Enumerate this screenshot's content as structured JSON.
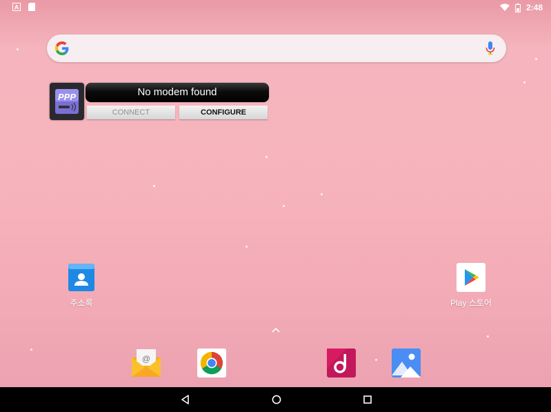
{
  "status_bar": {
    "time": "2:48",
    "notifications": [
      "font-a-icon",
      "sd-card-icon"
    ],
    "indicators": [
      "wifi-icon",
      "battery-icon"
    ]
  },
  "search": {
    "placeholder": "",
    "logo": "google-g-icon",
    "mic": "mic-icon"
  },
  "ppp_widget": {
    "icon_text": "PPP",
    "status": "No modem found",
    "connect_label": "CONNECT",
    "configure_label": "CONFIGURE"
  },
  "apps": {
    "contacts": {
      "label": "주소록",
      "icon": "contacts-icon"
    },
    "play_store": {
      "label": "Play 스토어",
      "icon": "play-store-icon"
    }
  },
  "dock": [
    {
      "name": "email",
      "icon": "email-icon"
    },
    {
      "name": "chrome",
      "icon": "chrome-icon"
    },
    {
      "name": "music",
      "icon": "music-icon"
    },
    {
      "name": "gallery",
      "icon": "gallery-icon"
    }
  ],
  "nav": [
    "back-icon",
    "home-icon",
    "recents-icon"
  ],
  "colors": {
    "wallpaper_top": "#e99aa6",
    "wallpaper_mid": "#f7b3bc",
    "google_blue": "#4285F4",
    "google_red": "#EA4335",
    "google_yellow": "#FBBC05",
    "google_green": "#34A853",
    "contacts_blue": "#1e88e5",
    "music_red": "#d81b60"
  }
}
